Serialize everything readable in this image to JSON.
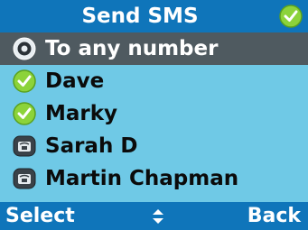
{
  "title": "Send SMS",
  "title_icon": "skype-online-icon",
  "contacts": [
    {
      "label": "To any number",
      "icon": "skype-phone-icon",
      "selected": true
    },
    {
      "label": "Dave",
      "icon": "skype-online-icon",
      "selected": false
    },
    {
      "label": "Marky",
      "icon": "skype-online-icon",
      "selected": false
    },
    {
      "label": "Sarah D",
      "icon": "skype-contact-phone-icon",
      "selected": false
    },
    {
      "label": "Martin Chapman",
      "icon": "skype-contact-phone-icon",
      "selected": false
    }
  ],
  "softkeys": {
    "left": "Select",
    "center_icon": "up-down-arrows-icon",
    "right": "Back"
  },
  "colors": {
    "bar": "#0f75ba",
    "background": "#6fc9e6",
    "selection": "#4f5a60",
    "online_green": "#8cd33a"
  }
}
